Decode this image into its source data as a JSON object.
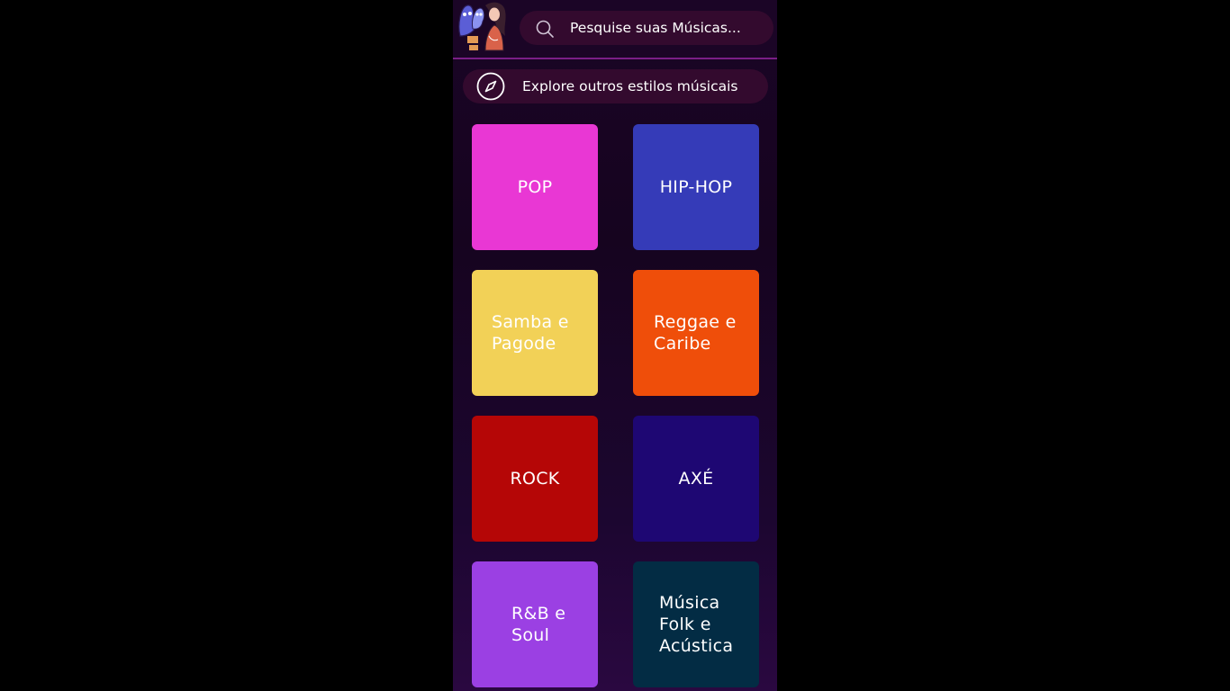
{
  "search": {
    "placeholder": "Pesquise suas Músicas..."
  },
  "explore": {
    "label": "Explore outros estilos músicais"
  },
  "genres": [
    {
      "label": "POP",
      "color": "#e937d4"
    },
    {
      "label": "HIP-HOP",
      "color": "#353bb8"
    },
    {
      "label": "Samba e Pagode",
      "color": "#f2d157"
    },
    {
      "label": "Reggae e Caribe",
      "color": "#ef4e0a"
    },
    {
      "label": "ROCK",
      "color": "#b50606"
    },
    {
      "label": "AXÉ",
      "color": "#1e0773"
    },
    {
      "label": "R&B e Soul",
      "color": "#9b40e3"
    },
    {
      "label": "Música Folk e Acústica",
      "color": "#032c44"
    }
  ],
  "icons": {
    "logo": "ghost-girl-logo",
    "search": "search-icon",
    "explore": "compass-icon"
  },
  "colors": {
    "background": "#16041f",
    "pill": "#330a2e",
    "divider": "#7a1f86"
  }
}
